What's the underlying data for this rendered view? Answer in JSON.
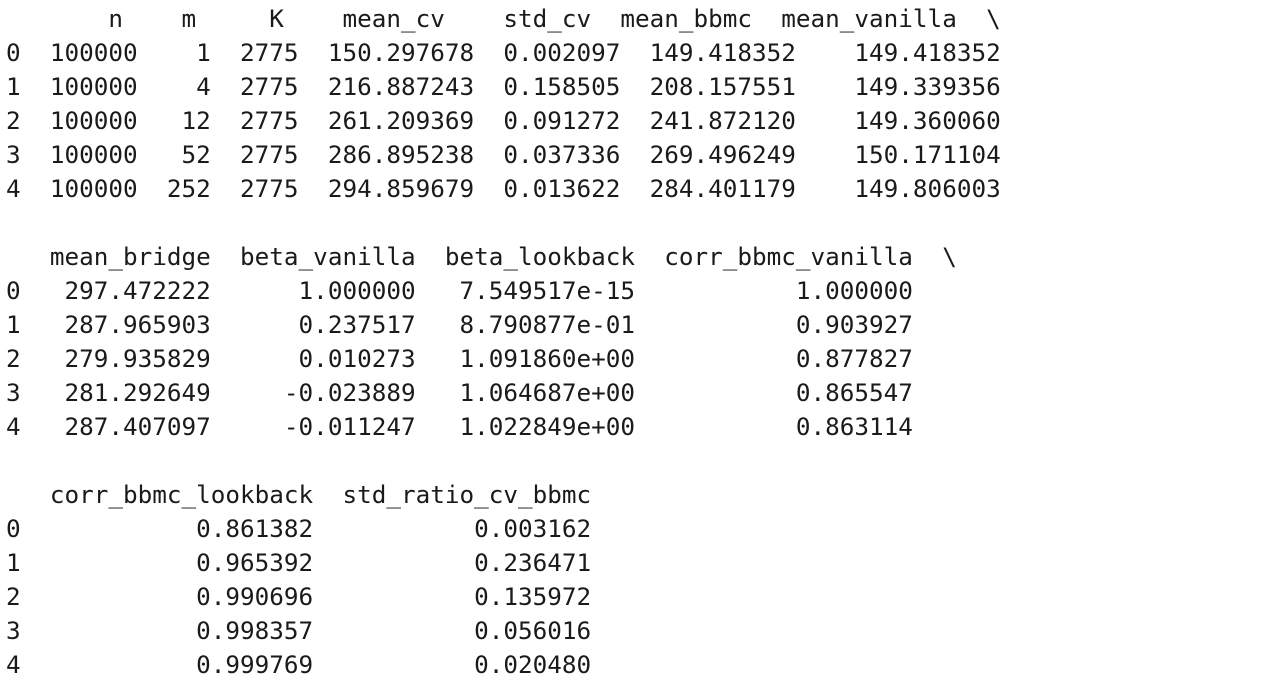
{
  "output_lines": [
    "       n    m     K    mean_cv    std_cv  mean_bbmc  mean_vanilla  \\",
    "0  100000    1  2775  150.297678  0.002097  149.418352    149.418352",
    "1  100000    4  2775  216.887243  0.158505  208.157551    149.339356",
    "2  100000   12  2775  261.209369  0.091272  241.872120    149.360060",
    "3  100000   52  2775  286.895238  0.037336  269.496249    150.171104",
    "4  100000  252  2775  294.859679  0.013622  284.401179    149.806003",
    "",
    "   mean_bridge  beta_vanilla  beta_lookback  corr_bbmc_vanilla  \\",
    "0   297.472222      1.000000   7.549517e-15           1.000000",
    "1   287.965903      0.237517   8.790877e-01           0.903927",
    "2   279.935829      0.010273   1.091860e+00           0.877827",
    "3   281.292649     -0.023889   1.064687e+00           0.865547",
    "4   287.407097     -0.011247   1.022849e+00           0.863114",
    "",
    "   corr_bbmc_lookback  std_ratio_cv_bbmc",
    "0            0.861382           0.003162",
    "1            0.965392           0.236471",
    "2            0.990696           0.135972",
    "3            0.998357           0.056016",
    "4            0.999769           0.020480"
  ]
}
